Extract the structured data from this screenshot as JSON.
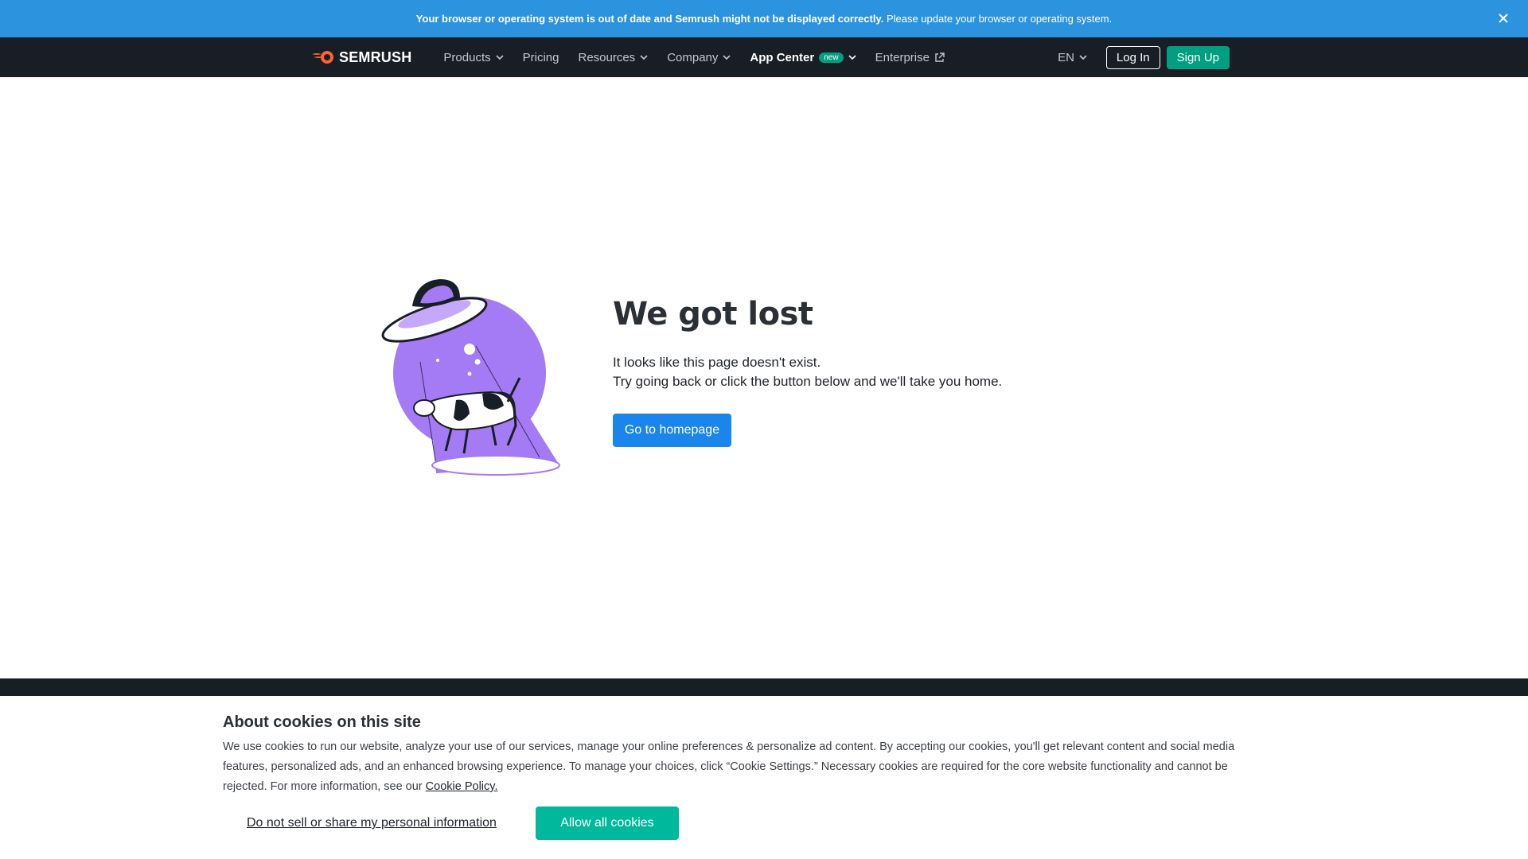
{
  "banner": {
    "bold_text": "Your browser or operating system is out of date and Semrush might not be displayed correctly.",
    "text": " Please update your browser or operating system.",
    "close_icon": "close-icon"
  },
  "nav": {
    "logo_text": "SEMRUSH",
    "products": "Products",
    "pricing": "Pricing",
    "resources": "Resources",
    "company": "Company",
    "app_center": "App Center",
    "new_badge": "new",
    "enterprise": "Enterprise",
    "lang": "EN",
    "login": "Log In",
    "signup": "Sign Up"
  },
  "main": {
    "title": "We got lost",
    "line1": "It looks like this page doesn't exist.",
    "line2": "Try going back or click the button below and we'll take you home.",
    "button": "Go to homepage"
  },
  "cookie": {
    "title": "About cookies on this site",
    "body": "We use cookies to run our website, analyze your use of our services, manage your online preferences & personalize ad content. By accepting our cookies, you'll get relevant content and social media features, personalized ads, and an enhanced browsing experience. To manage your choices, click “Cookie Settings.” Necessary cookies are required for the core website functionality and cannot be rejected. For more information, see our ",
    "policy_link": "Cookie Policy.",
    "do_not_sell": "Do not sell or share my personal information",
    "allow_all": "Allow all cookies"
  },
  "colors": {
    "banner": "#2c93de",
    "nav": "#181e25",
    "brand_green": "#009f81",
    "primary_blue": "#1a85ea",
    "illus_purple": "#a57bf5",
    "allow_green": "#00b89b"
  }
}
